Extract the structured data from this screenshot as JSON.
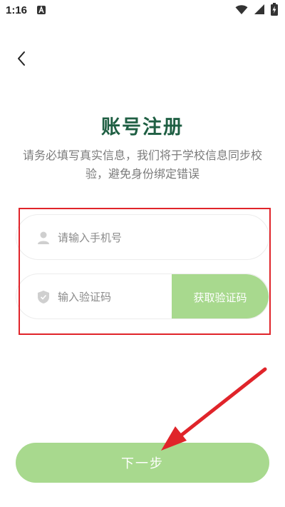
{
  "status_bar": {
    "time": "1:16",
    "icons": [
      "a-notification-icon",
      "wifi-icon",
      "cellular-signal-icon",
      "battery-charging-icon"
    ]
  },
  "nav": {
    "back_icon": "chevron-left-icon"
  },
  "header": {
    "title": "账号注册",
    "subtitle": "请务必填写真实信息，我们将于学校信息同步校验，避免身份绑定错误"
  },
  "form": {
    "phone": {
      "placeholder": "请输入手机号",
      "value": "",
      "icon": "user-icon"
    },
    "code": {
      "placeholder": "输入验证码",
      "value": "",
      "icon": "shield-icon"
    },
    "get_code_label": "获取验证码"
  },
  "actions": {
    "next_label": "下一步"
  },
  "colors": {
    "title": "#1f5f43",
    "accent_green": "#a8d98e",
    "annotation_red": "#e0242a"
  }
}
